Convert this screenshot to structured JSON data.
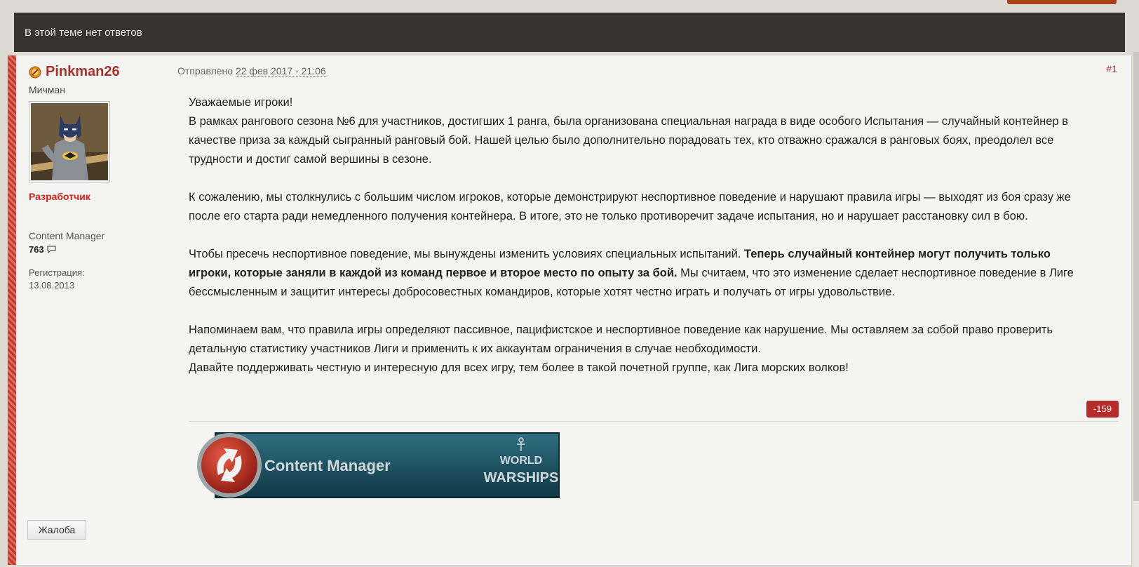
{
  "topic_bar": {
    "text": "В этой теме нет ответов"
  },
  "author": {
    "name": "Pinkman26",
    "rank": "Мичман",
    "role": "Разработчик",
    "group": "Content Manager",
    "post_count": "763",
    "registration_label": "Регистрация:",
    "registration_date": "13.08.2013"
  },
  "post": {
    "sent_prefix": "Отправлено",
    "date": "22 фев 2017 - 21:06",
    "number": "#1",
    "greeting": "Уважаемые игроки!",
    "p1": "В рамках рангового сезона №6 для участников, достигших 1 ранга, была организована специальная награда в виде особого Испытания — случайный контейнер в качестве приза за каждый сыгранный ранговый бой. Нашей целью было дополнительно порадовать тех, кто отважно сражался в ранговых боях, преодолел все трудности и достиг самой вершины в сезоне.",
    "p2": "К сожалению, мы столкнулись с большим числом игроков, которые демонстрируют неспортивное поведение и нарушают правила игры — выходят из боя сразу же после его старта ради немедленного получения контейнера. В итоге, это не только противоречит задаче испытания, но и нарушает расстановку сил в бою.",
    "p3_a": "Чтобы пресечь неспортивное поведение, мы вынуждены изменить условиях специальных испытаний.",
    "p3_bold": "Теперь случайный контейнер могут получить только игроки, которые заняли в каждой из команд первое и второе место по опыту за бой.",
    "p3_b": "Мы считаем, что это изменение сделает неспортивное поведение в Лиге бессмысленным и защитит интересы добросовестных командиров, которые хотят честно играть и получать от игры удовольствие.",
    "p4": "Напоминаем вам, что правила игры определяют пассивное, пацифистское и неспортивное поведение как нарушение. Мы оставляем за собой право проверить детальную статистику участников Лиги и применить к их аккаунтам ограничения в случае необходимости.",
    "p5": "Давайте поддерживать честную и интересную для всех игру, тем более в такой почетной группе, как Лига морских волков!",
    "reputation": "-159"
  },
  "signature": {
    "title": "Content Manager",
    "logo_top": "WORLD",
    "logo_bottom": "WARSHIPS"
  },
  "actions": {
    "report_label": "Жалоба"
  },
  "colors": {
    "accent": "#a8322b",
    "role": "#d9201c",
    "reputation_bg": "#b72b2b",
    "bar_bg": "#36352f"
  }
}
